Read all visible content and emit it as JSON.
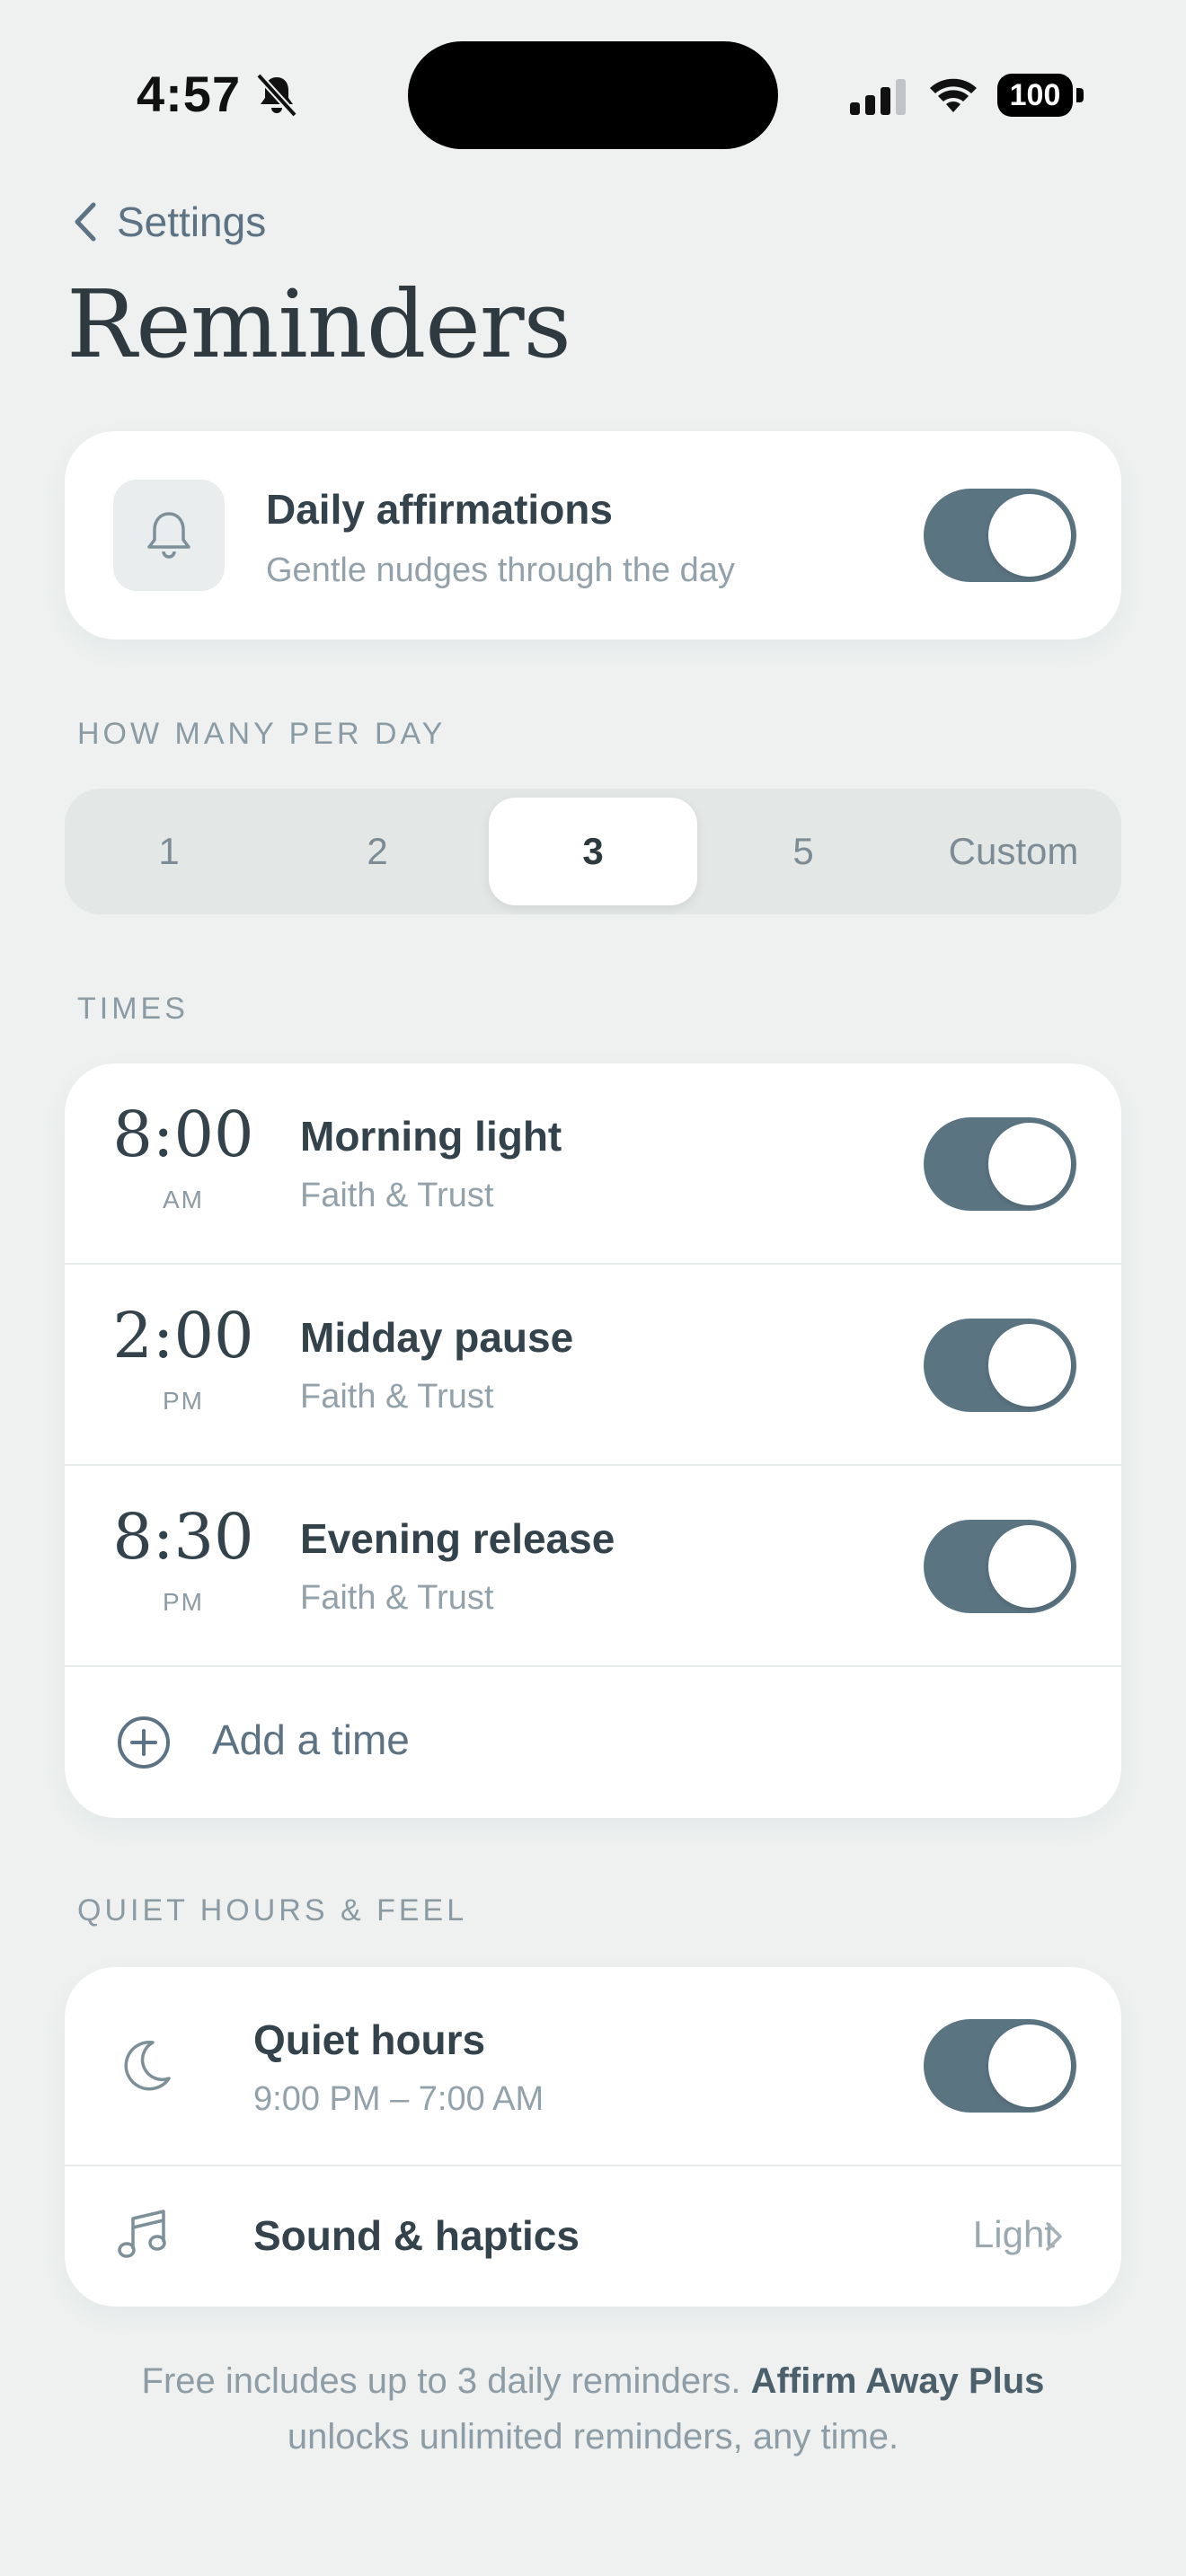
{
  "status": {
    "time": "4:57",
    "battery": "100"
  },
  "nav": {
    "back_label": "Settings",
    "title": "Reminders"
  },
  "daily": {
    "title": "Daily affirmations",
    "subtitle": "Gentle nudges through the day",
    "enabled": true
  },
  "per_day": {
    "label": "HOW MANY PER DAY",
    "options": [
      "1",
      "2",
      "3",
      "5",
      "Custom"
    ],
    "selected": "3"
  },
  "times": {
    "label": "TIMES",
    "items": [
      {
        "time": "8:00",
        "meridiem": "AM",
        "title": "Morning light",
        "category": "Faith & Trust",
        "enabled": true
      },
      {
        "time": "2:00",
        "meridiem": "PM",
        "title": "Midday pause",
        "category": "Faith & Trust",
        "enabled": true
      },
      {
        "time": "8:30",
        "meridiem": "PM",
        "title": "Evening release",
        "category": "Faith & Trust",
        "enabled": true
      }
    ],
    "add_label": "Add a time"
  },
  "quiet": {
    "label": "QUIET HOURS & FEEL",
    "quiet_title": "Quiet hours",
    "quiet_range": "9:00 PM – 7:00 AM",
    "quiet_enabled": true,
    "sound_title": "Sound & haptics",
    "sound_value": "Light"
  },
  "footnote": {
    "part1": "Free includes up to 3 daily reminders.",
    "brand": "Affirm Away Plus",
    "part2": "unlocks unlimited reminders, any time."
  },
  "colors": {
    "background": "#EEF1F0",
    "accent": "#5B7482",
    "card": "#FFFFFF"
  }
}
